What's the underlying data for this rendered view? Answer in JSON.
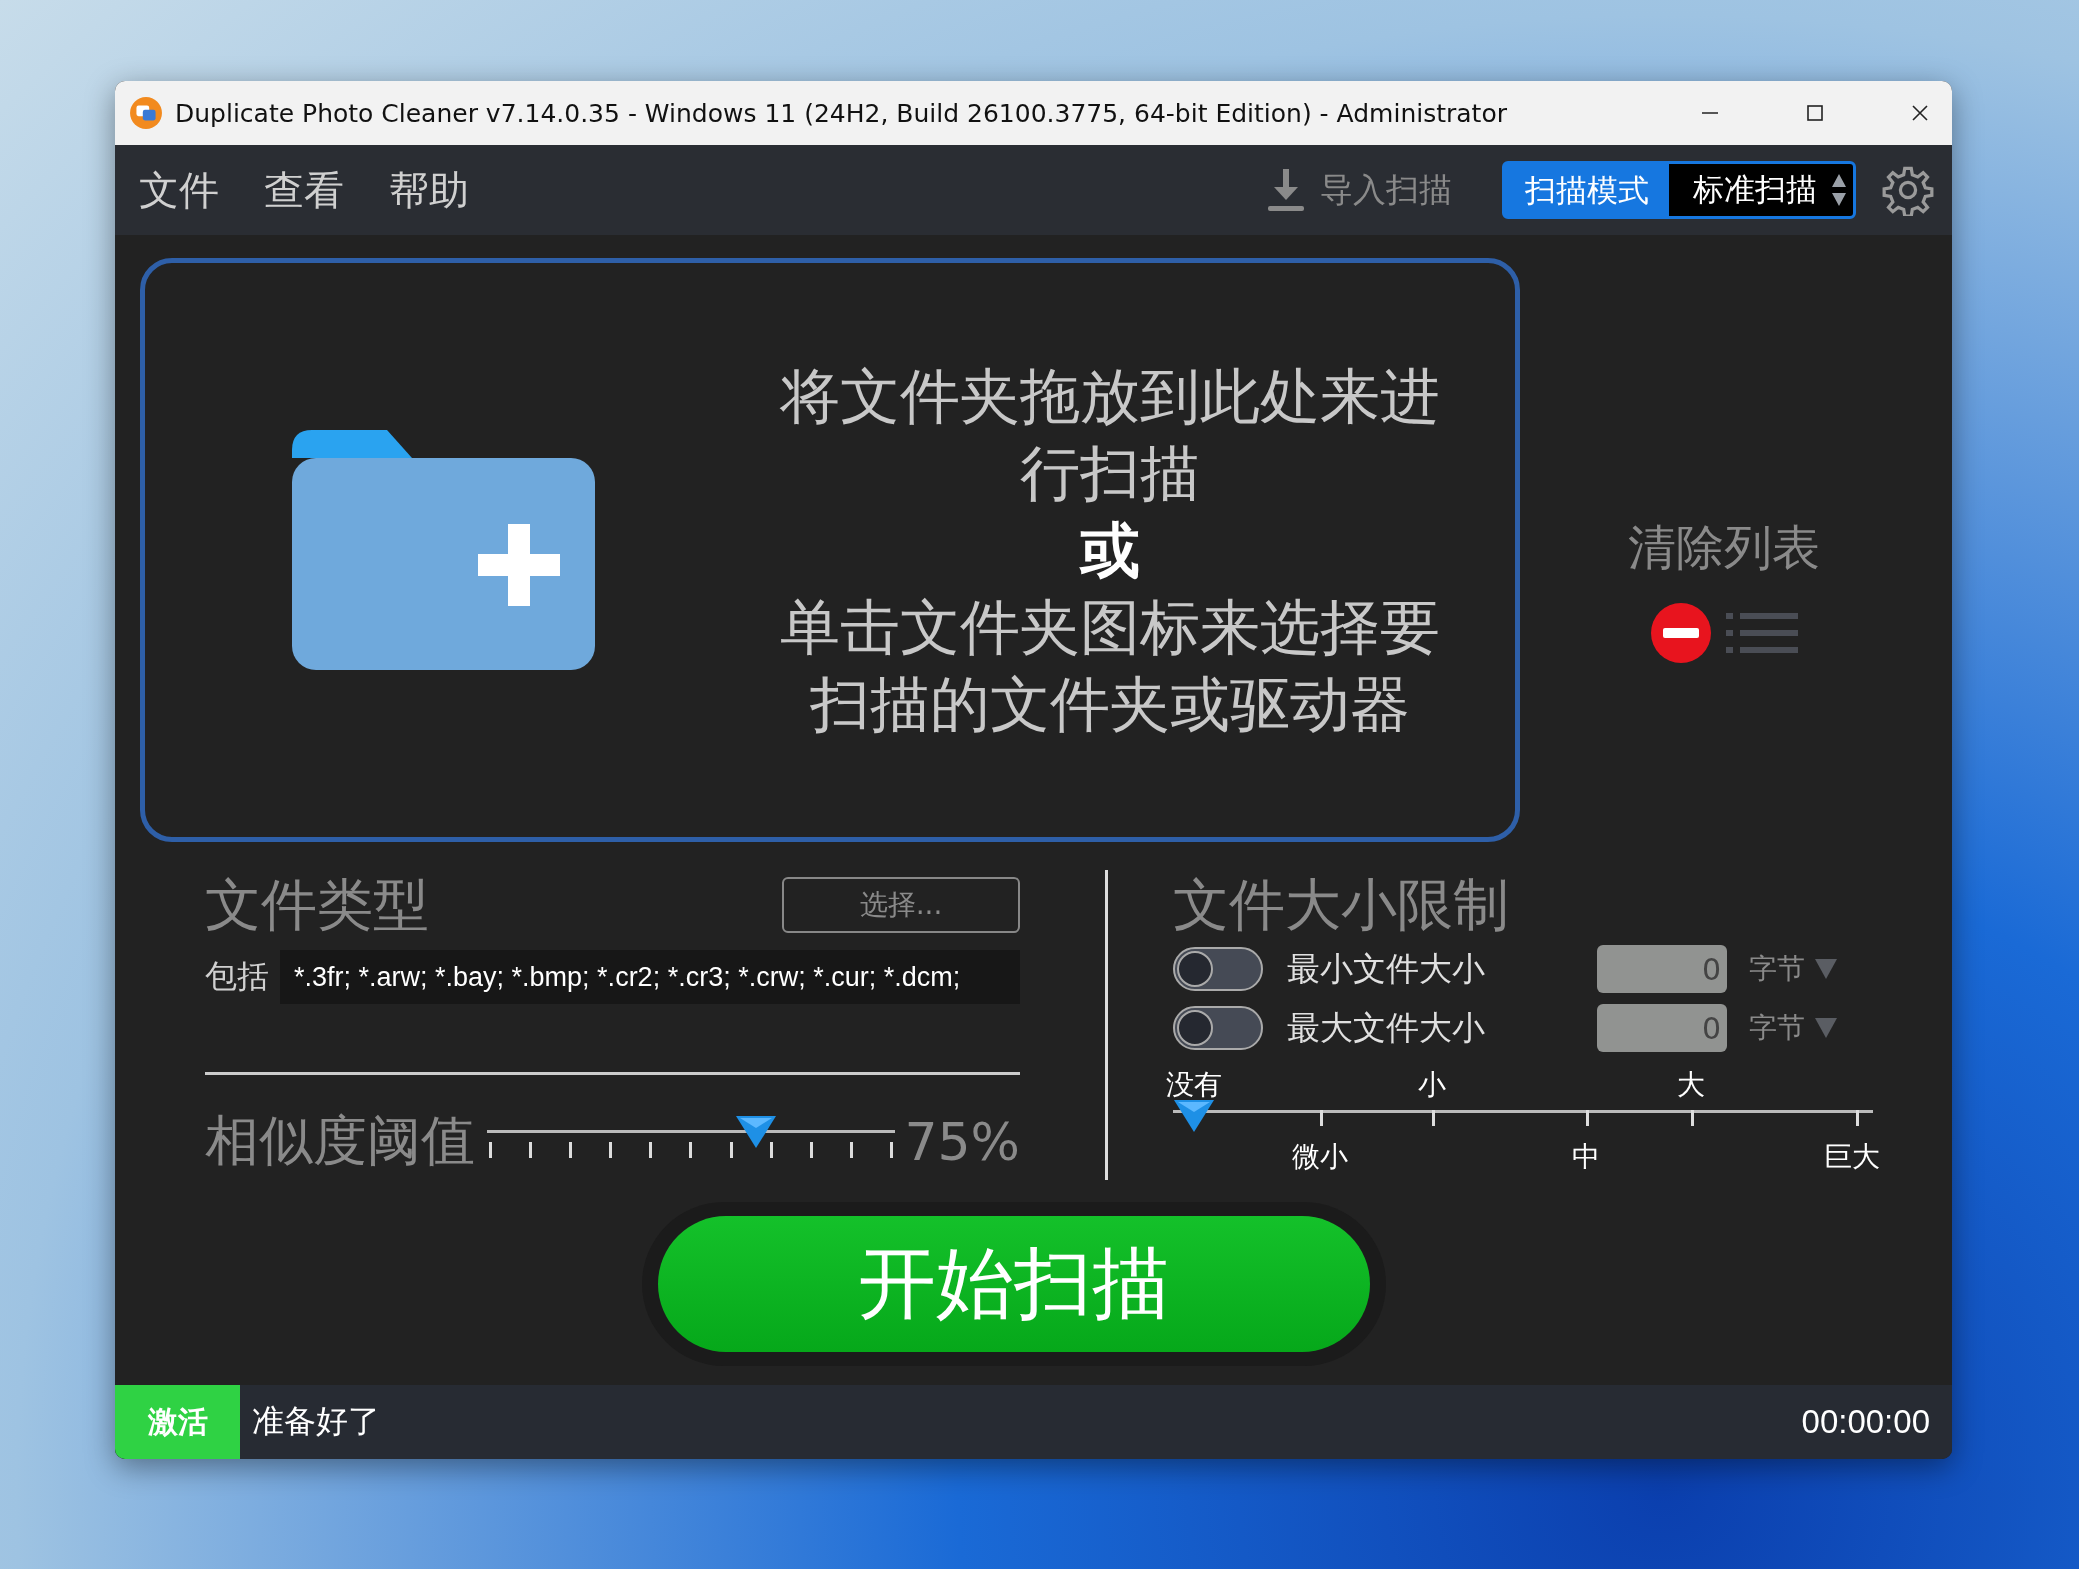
{
  "window": {
    "title": "Duplicate Photo Cleaner v7.14.0.35 - Windows 11 (24H2, Build 26100.3775, 64-bit Edition) - Administrator"
  },
  "menu": [
    "文件",
    "查看",
    "帮助"
  ],
  "toolbar": {
    "import_label": "导入扫描",
    "scan_mode_label": "扫描模式",
    "scan_mode_value": "标准扫描"
  },
  "drop_zone": {
    "lines": [
      {
        "text": "将文件夹拖放到此处来进行扫描",
        "kind": "normal"
      },
      {
        "text": "或",
        "kind": "emphasis"
      },
      {
        "text": "单击文件夹图标来选择要扫描的文件夹或驱动器",
        "kind": "normal"
      }
    ]
  },
  "clear_list": {
    "label": "清除列表"
  },
  "file_types": {
    "title": "文件类型",
    "choose_button": "选择...",
    "include_label": "包括",
    "include_value": "*.3fr; *.arw; *.bay; *.bmp; *.cr2; *.cr3; *.crw; *.cur; *.dcm;"
  },
  "similarity": {
    "label": "相似度阈值",
    "level": 0.66,
    "reading": "75%"
  },
  "size_limit": {
    "title": "文件大小限制",
    "rows": [
      {
        "label": "最小文件大小",
        "on": false,
        "value": "0",
        "unit": "字节"
      },
      {
        "label": "最大文件大小",
        "on": false,
        "value": "0",
        "unit": "字节"
      }
    ],
    "scale_top": [
      "没有",
      "小",
      "大"
    ],
    "scale_bottom": [
      "微小",
      "中",
      "巨大"
    ],
    "level": 0
  },
  "start_button": "开始扫描",
  "status_bar": {
    "activate": "激活",
    "message": "准备好了",
    "time": "00:00:00"
  }
}
